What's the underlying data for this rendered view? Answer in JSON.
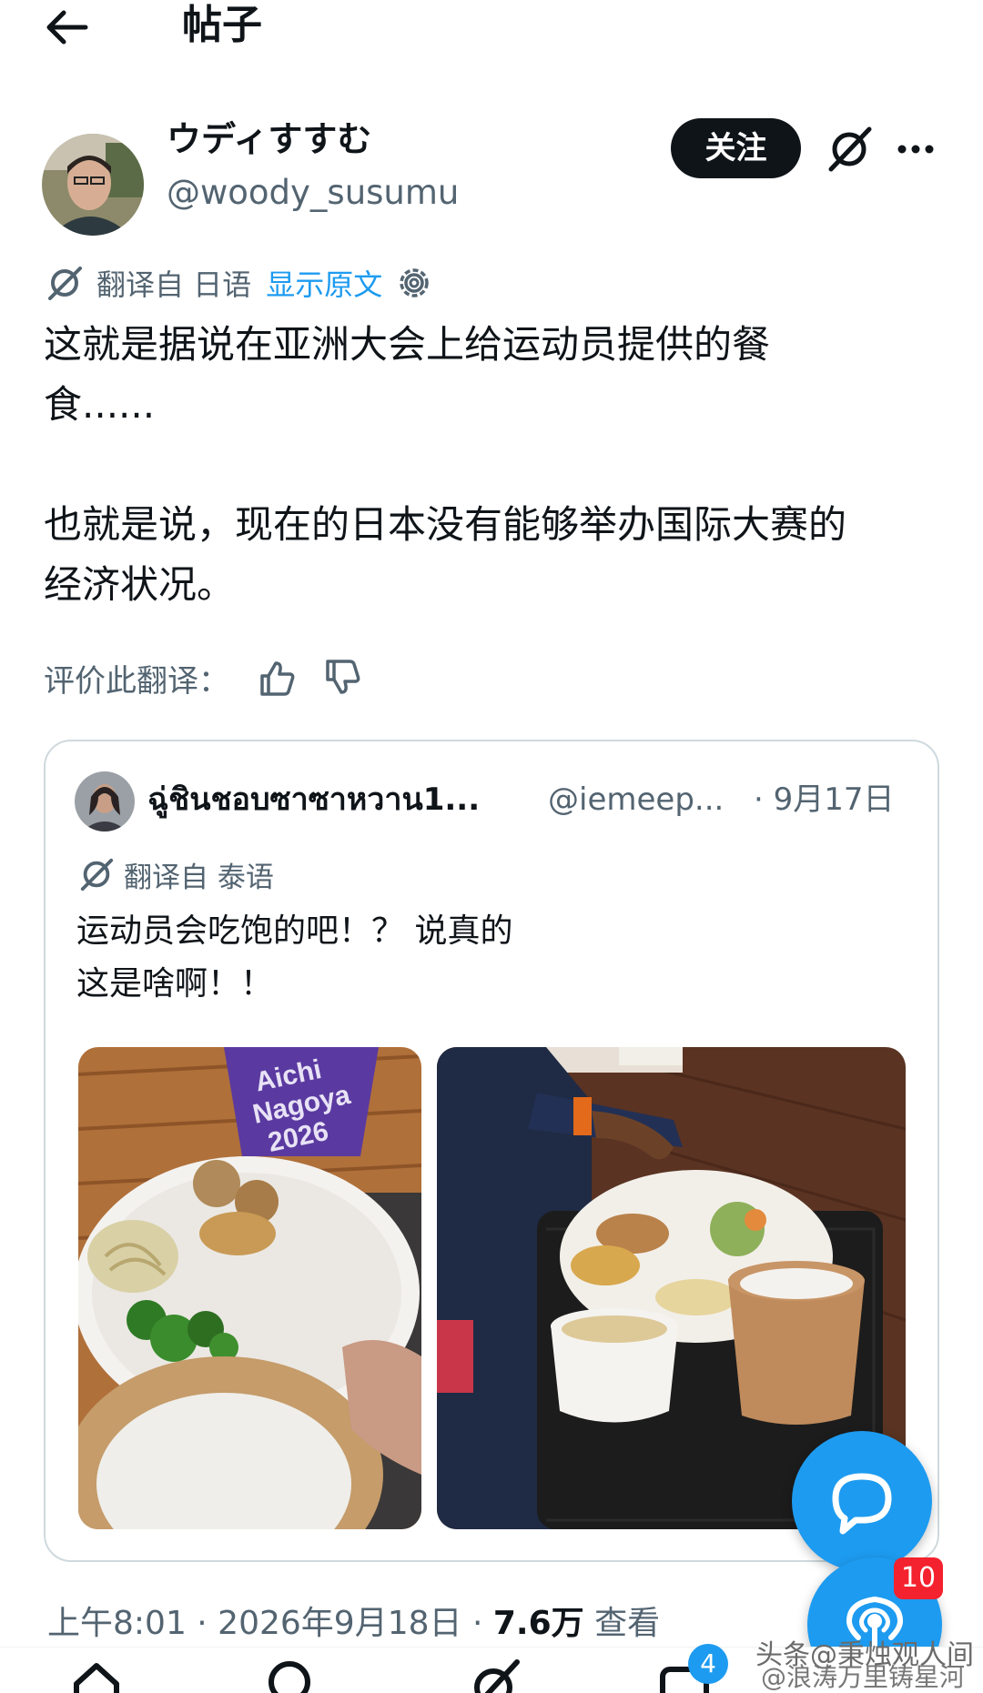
{
  "header": {
    "title": "帖子"
  },
  "post": {
    "author_name": "ウディすすむ",
    "author_handle": "@woody_susumu",
    "follow_label": "关注",
    "translated_from": "翻译自 日语",
    "show_original": "显示原文",
    "text": "这就是据说在亚洲大会上给运动员提供的餐\n食......\n\n也就是说，现在的日本没有能够举办国际大赛的\n经济状况。",
    "rate_label": "评价此翻译：",
    "timestamp_line": "上午8:01 · 2026年9月18日 · ",
    "views": "7.6万",
    "views_label": " 查看"
  },
  "quote": {
    "name": "ฉู่ชินชอบซาซาหวาน1...",
    "handle": "@iemeep...",
    "date": "· 9月17日",
    "translated_from": "翻译自 泰语",
    "text": "运动员会吃饱的吧！？ 说真的\n这是啥啊！！",
    "photo1_sign": "Aichi\nNagoya\n2026"
  },
  "fab": {
    "badge_count": "10"
  },
  "nav": {
    "badge_count": "4"
  },
  "watermark": {
    "line1": "头条@秉烛观人间",
    "line2": "@浪涛万里铸星河"
  },
  "colors": {
    "accent": "#1d9bf0",
    "text": "#0f1419",
    "secondary": "#536471",
    "badge": "#f4212e"
  },
  "icons": [
    "back-arrow-icon",
    "grok-icon",
    "more-icon",
    "translate-icon",
    "settings-icon",
    "thumbs-up-icon",
    "thumbs-down-icon",
    "reply-icon",
    "spaces-icon",
    "home-icon",
    "search-icon",
    "grok-nav-icon",
    "messages-icon"
  ]
}
